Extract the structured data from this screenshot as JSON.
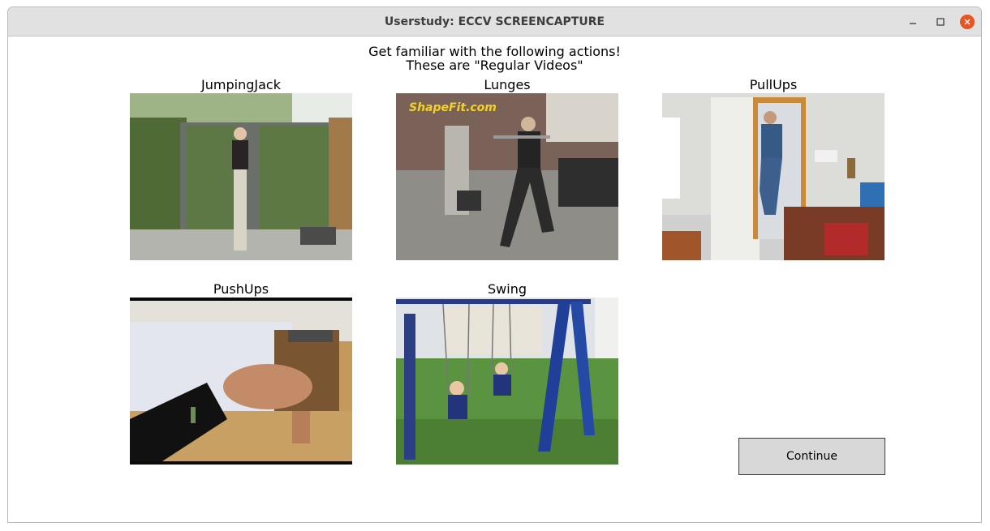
{
  "window": {
    "title": "Userstudy: ECCV SCREENCAPTURE",
    "controls": [
      "minimize-icon",
      "maximize-icon",
      "close-icon"
    ],
    "close_color": "#e95420"
  },
  "heading": {
    "line1": "Get familiar with the following actions!",
    "line2": "These are \"Regular Videos\""
  },
  "clips": [
    {
      "label": "JumpingJack"
    },
    {
      "label": "Lunges",
      "watermark": "ShapeFit.com"
    },
    {
      "label": "PullUps"
    },
    {
      "label": "PushUps"
    },
    {
      "label": "Swing"
    }
  ],
  "continue_label": "Continue"
}
